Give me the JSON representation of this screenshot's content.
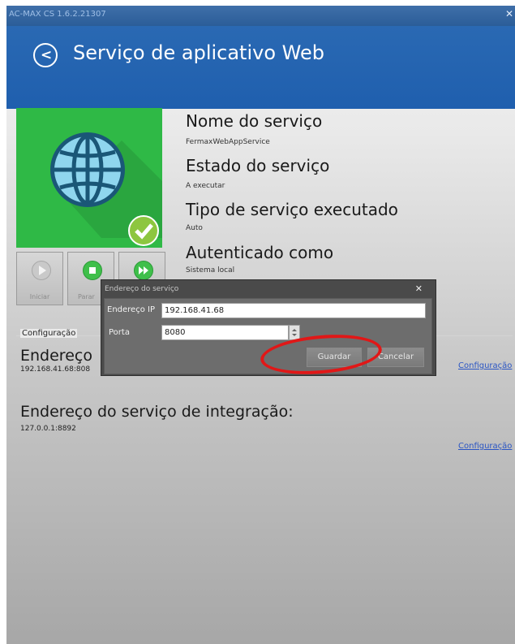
{
  "window": {
    "title": "AC-MAX CS 1.6.2.21307",
    "close_icon": "close-icon"
  },
  "header": {
    "back_icon": "back-arrow-icon",
    "title": "Serviço de aplicativo Web",
    "color": "#1f5fae"
  },
  "service": {
    "name_label": "Nome do serviço",
    "name_value": "FermaxWebAppService",
    "state_label": "Estado do serviço",
    "state_value": "A executar",
    "type_label": "Tipo de serviço executado",
    "type_value": "Auto",
    "auth_label": "Autenticado como",
    "auth_value": "Sistema local"
  },
  "controls": {
    "start_label": "Iniciar",
    "stop_label": "Parar",
    "restart_label": "",
    "icons": [
      "play-icon",
      "stop-icon",
      "fast-forward-icon"
    ]
  },
  "config": {
    "section_label": "Configuração",
    "address_title": "Endereço",
    "address_value": "192.168.41.68:808",
    "link_label": "Configuração",
    "integration_title": "Endereço do serviço de integração:",
    "integration_value": "127.0.0.1:8892"
  },
  "dialog": {
    "title": "Endereço do serviço",
    "ip_label": "Endereço IP",
    "ip_value": "192.168.41.68",
    "port_label": "Porta",
    "port_value": "8080",
    "save_label": "Guardar",
    "cancel_label": "Cancelar"
  },
  "accent": {
    "tile_green": "#2fb946",
    "annotation_red": "#e11717"
  }
}
